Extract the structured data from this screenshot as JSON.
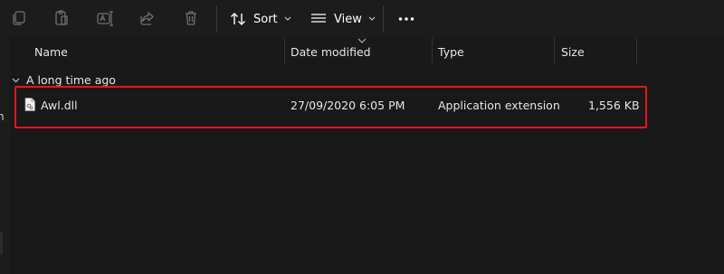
{
  "toolbar": {
    "icons": [
      "copy-icon",
      "paste-icon",
      "rename-icon",
      "share-icon",
      "delete-icon"
    ],
    "sort_label": "Sort",
    "view_label": "View",
    "more_icon": "more-icon"
  },
  "columns": {
    "name": "Name",
    "date_modified": "Date modified",
    "type": "Type",
    "size": "Size"
  },
  "group": {
    "label": "A long time ago",
    "expanded": true
  },
  "files": [
    {
      "name": "Awl.dll",
      "date_modified": "27/09/2020 6:05 PM",
      "type": "Application extension",
      "size": "1,556 KB",
      "icon": "dll-file-icon"
    }
  ],
  "colors": {
    "background": "#191919",
    "highlight": "#e8141e",
    "text": "#e6e6e6",
    "icon_dim": "#8a8a8a"
  },
  "left_strip": {
    "letter": "n"
  }
}
